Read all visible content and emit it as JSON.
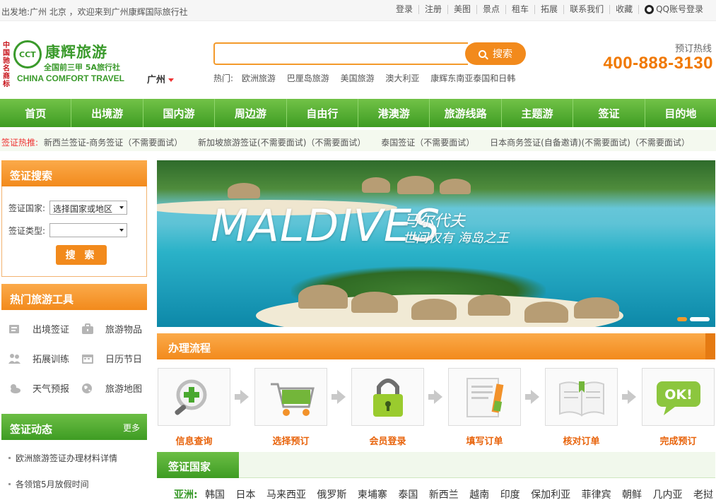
{
  "topbar": {
    "welcome": "出发地:广州 北京 ，欢迎来到广州康辉国际旅行社",
    "links": [
      "登录",
      "注册",
      "美图",
      "景点",
      "租车",
      "拓展",
      "联系我们",
      "收藏"
    ],
    "qq_login": "QQ账号登录"
  },
  "logo": {
    "seal": "中国驰名商标",
    "mark": "CCT",
    "brand": "康辉旅游",
    "tagline": "全国前三甲 5A旅行社",
    "english": "CHINA COMFORT TRAVEL"
  },
  "city": "广州",
  "search": {
    "placeholder": "",
    "button": "搜索",
    "hot_label": "热门:",
    "hot": [
      "欧洲旅游",
      "巴厘岛旅游",
      "美国旅游",
      "澳大利亚",
      "康辉东南亚泰国和日韩"
    ]
  },
  "hotline": {
    "label": "预订热线",
    "number": "400-888-3130"
  },
  "nav": [
    "首页",
    "出境游",
    "国内游",
    "周边游",
    "自由行",
    "港澳游",
    "旅游线路",
    "主题游",
    "签证",
    "目的地"
  ],
  "visa_hot": {
    "label": "签证热推:",
    "items": [
      "新西兰签证-商务签证（不需要面试）",
      "新加坡旅游签证(不需要面试)（不需要面试）",
      "泰国签证（不需要面试）",
      "日本商务签证(自备邀请)(不需要面试)（不需要面试）"
    ]
  },
  "visa_search": {
    "title": "签证搜索",
    "country_label": "签证国家:",
    "country_value": "选择国家或地区",
    "type_label": "签证类型:",
    "type_value": "",
    "button": "搜 索"
  },
  "tools": {
    "title": "热门旅游工具",
    "items": [
      "出境签证",
      "旅游物品",
      "拓展训练",
      "日历节日",
      "天气预报",
      "旅游地图"
    ]
  },
  "news": {
    "title": "签证动态",
    "more": "更多",
    "items": [
      "欧洲旅游签证办理材料详情",
      "各领馆5月放假时间"
    ]
  },
  "banner": {
    "title_en": "MALDIVES",
    "title_cn": "马尔代夫",
    "subtitle": "世间仅有 海岛之王"
  },
  "process": {
    "title": "办理流程",
    "steps": [
      "信息查询",
      "选择预订",
      "会员登录",
      "填写订单",
      "核对订单",
      "完成预订"
    ]
  },
  "visa_countries": {
    "title": "签证国家",
    "region": "亚洲:",
    "countries": [
      "韩国",
      "日本",
      "马来西亚",
      "俄罗斯",
      "柬埔寨",
      "泰国",
      "新西兰",
      "越南",
      "印度",
      "保加利亚",
      "菲律宾",
      "朝鲜",
      "几内亚",
      "老挝"
    ]
  },
  "colors": {
    "green": "#3e9c23",
    "orange": "#f28a1c",
    "hotline": "#f07800",
    "accent_red": "#e33333"
  }
}
